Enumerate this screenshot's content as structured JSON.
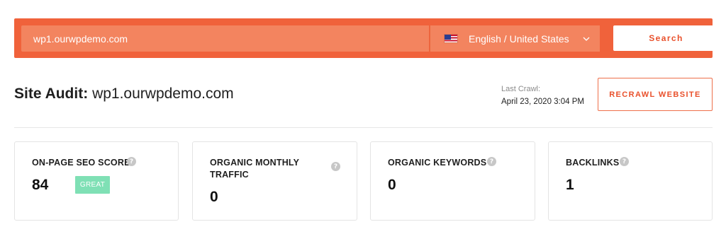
{
  "search": {
    "url_value": "wp1.ourwpdemo.com",
    "language": "English / United States",
    "language_flag": "us-flag-icon",
    "search_label": "Search"
  },
  "header": {
    "title_label": "Site Audit:",
    "site": "wp1.ourwpdemo.com",
    "last_crawl_label": "Last Crawl:",
    "last_crawl_date": "April 23, 2020 3:04 PM",
    "recrawl_label": "RECRAWL WEBSITE"
  },
  "cards": [
    {
      "title": "ON-PAGE SEO SCORE",
      "value": "84",
      "badge": "GREAT"
    },
    {
      "title": "ORGANIC MONTHLY TRAFFIC",
      "value": "0"
    },
    {
      "title": "ORGANIC KEYWORDS",
      "value": "0"
    },
    {
      "title": "BACKLINKS",
      "value": "1"
    }
  ],
  "colors": {
    "brand_orange": "#f0623b",
    "input_orange": "#f3845f",
    "badge_green": "#7fe0b5"
  },
  "icons": {
    "info": "info-icon",
    "chevron": "chevron-down-icon"
  }
}
